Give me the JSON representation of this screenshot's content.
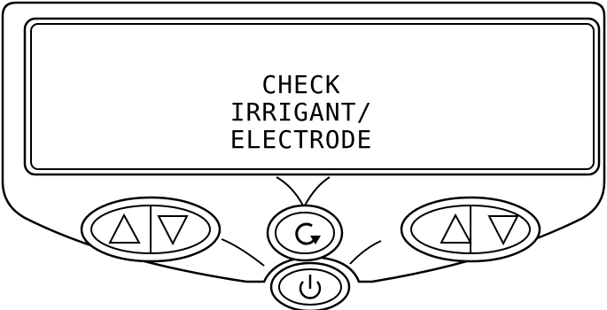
{
  "display": {
    "lines": [
      "CHECK",
      "IRRIGANT/",
      "ELECTRODE"
    ]
  },
  "controls": {
    "left_pair": [
      "up-arrow-icon",
      "down-arrow-icon"
    ],
    "center": "refresh-cycle-icon",
    "right_pair": [
      "up-arrow-icon",
      "down-arrow-icon"
    ],
    "power": "power-icon"
  }
}
